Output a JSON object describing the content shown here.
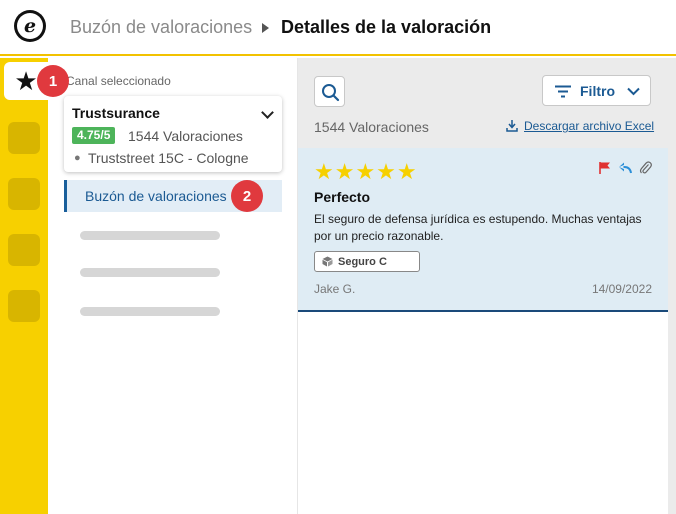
{
  "header": {
    "logo_letter": "e",
    "breadcrumb_parent": "Buzón de valoraciones",
    "breadcrumb_current": "Detalles de la valoración"
  },
  "rail": {
    "active_icon": "star-icon",
    "badge1": "1",
    "badge2": "2"
  },
  "channel": {
    "section_label": "Canal seleccionado",
    "name": "Trustsurance",
    "score": "4.75/5",
    "review_count": "1544 Valoraciones",
    "address": "Truststreet 15C - Cologne"
  },
  "sidebar": {
    "inbox_label": "Buzón de valoraciones"
  },
  "toolbar": {
    "filter_label": "Filtro",
    "count_text": "1544 Valoraciones",
    "download_label": "Descargar archivo Excel"
  },
  "review": {
    "stars": "★★★★★",
    "rating": 5,
    "title": "Perfecto",
    "body": "El seguro de defensa jurídica es estupendo. Muchas ventajas por un precio razonable.",
    "tag": "Seguro C",
    "author": "Jake G.",
    "date": "14/09/2022"
  },
  "colors": {
    "brand_yellow": "#f7d000",
    "accent_blue": "#1b5a93",
    "score_green": "#4db45a",
    "badge_red": "#e0393e",
    "flag_red": "#e03131",
    "reply_blue": "#2b8fd8"
  }
}
